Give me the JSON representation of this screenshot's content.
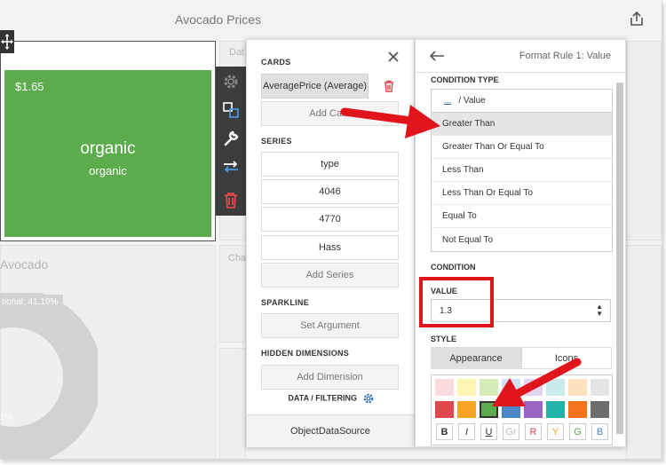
{
  "dashboard": {
    "title": "Avocado Prices"
  },
  "background": {
    "tile_dat": "Dat",
    "tile_cha": "Cha",
    "pie_title": "Avocado",
    "pie_label": "tional: 41.19%",
    "pie_label2": "1%"
  },
  "card": {
    "price": "$1.65",
    "main": "organic",
    "sub": "organic",
    "color": "#5cab4c"
  },
  "bindings": {
    "cards_label": "CARDS",
    "card_item": "AveragePrice (Average)",
    "add_card": "Add Card",
    "series_label": "SERIES",
    "series": [
      "type",
      "4046",
      "4770",
      "Hass"
    ],
    "add_series": "Add Series",
    "sparkline_label": "SPARKLINE",
    "set_argument": "Set Argument",
    "hidden_label": "HIDDEN DIMENSIONS",
    "add_dimension": "Add Dimension",
    "data_filtering": "DATA / FILTERING",
    "datasource": "ObjectDataSource"
  },
  "format_rule": {
    "title": "Format Rule 1: Value",
    "condition_type_label": "CONDITION TYPE",
    "condition_type_glyph": "...",
    "condition_type_value": "/   Value",
    "conditions": [
      "Greater Than",
      "Greater Than Or Equal To",
      "Less Than",
      "Less Than Or Equal To",
      "Equal To",
      "Not Equal To"
    ],
    "condition_label": "CONDITION",
    "value_label": "VALUE",
    "value": "1.3",
    "style_label": "STYLE",
    "tab_appearance": "Appearance",
    "tab_icons": "Icons",
    "palette_row1": [
      "#fadadd",
      "#fdf5b3",
      "#d5ecb8",
      "#cfe3f6",
      "#e0d4ee",
      "#c9ecea",
      "#fde1c0",
      "#e4e4e4"
    ],
    "palette_row2": [
      "#e0474c",
      "#f6a623",
      "#5cab4c",
      "#4a86c8",
      "#9b63c4",
      "#22b3aa",
      "#f4731c",
      "#6e6e6e"
    ],
    "format_buttons": [
      {
        "label": "B",
        "color": "#333333"
      },
      {
        "label": "I",
        "color": "#333333"
      },
      {
        "label": "U",
        "color": "#333333"
      },
      {
        "label": "Gr",
        "color": "#bbbbbb"
      },
      {
        "label": "R",
        "color": "#e0474c"
      },
      {
        "label": "Y",
        "color": "#f6a623"
      },
      {
        "label": "G",
        "color": "#5cab4c"
      },
      {
        "label": "B",
        "color": "#4a86c8"
      }
    ]
  },
  "colors": {
    "annotation_red": "#e0141b",
    "accent_blue": "#2e6fb5"
  }
}
